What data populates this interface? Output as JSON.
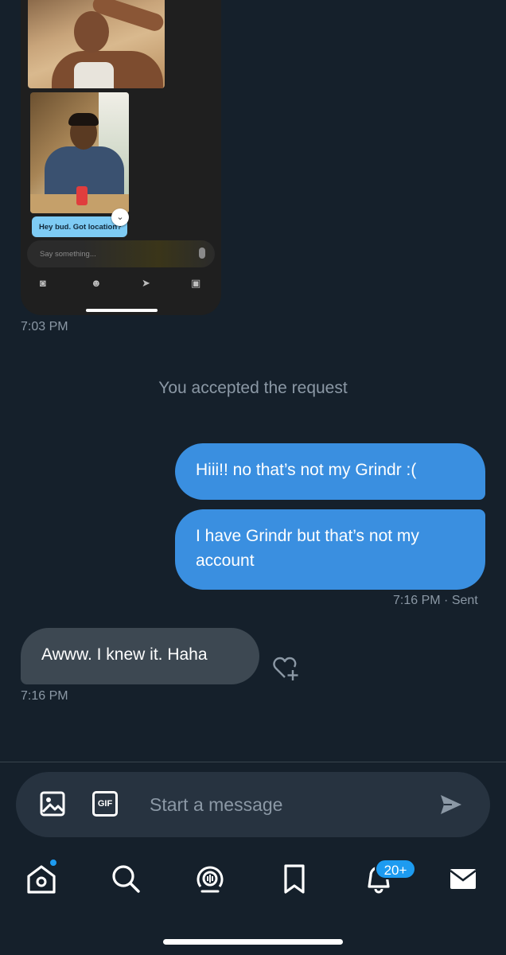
{
  "embedded_screenshot": {
    "bubble_text": "Hey bud. Got location?",
    "input_placeholder": "Say something..."
  },
  "timestamps": {
    "first": "7:03 PM",
    "sent": "7:16 PM",
    "sent_status": "· Sent",
    "received": "7:16 PM"
  },
  "system_message": "You accepted the request",
  "messages_out": [
    "Hiii!!  no that’s not my Grindr :(",
    "I have Grindr but that’s not my account"
  ],
  "message_in": "Awww. I knew it. Haha",
  "composer": {
    "placeholder": "Start a message",
    "gif_label": "GIF"
  },
  "tabbar": {
    "notifications_badge": "20+",
    "items": [
      "home-icon",
      "search-icon",
      "spaces-icon",
      "bookmark-icon",
      "notifications-icon",
      "messages-icon"
    ]
  },
  "colors": {
    "background": "#15202b",
    "outgoing_bubble": "#3a8fe0",
    "incoming_bubble": "#3d4852",
    "accent": "#1d9bf0"
  }
}
